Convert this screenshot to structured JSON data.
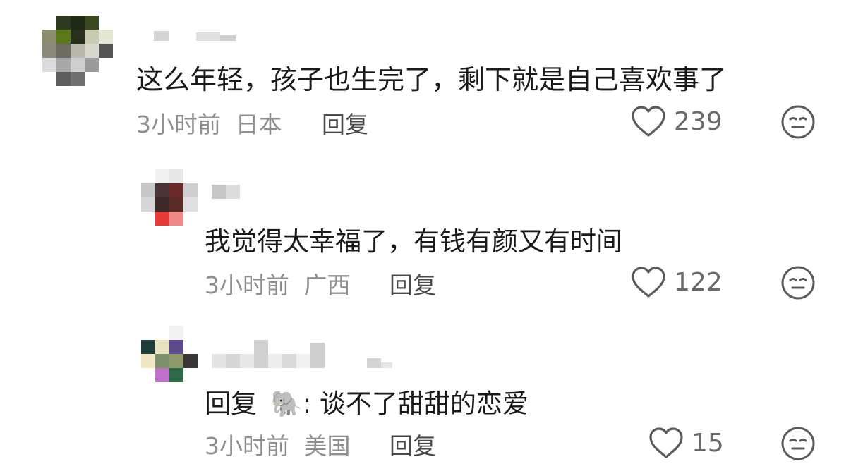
{
  "comments": [
    {
      "id": "c1",
      "text": "这么年轻，孩子也生完了，剩下就是自己喜欢事了",
      "time": "3小时前",
      "location": "日本",
      "reply_label": "回复",
      "likes": "239",
      "avatar_colors": [
        "#ffffff",
        "#2f3b21",
        "#1e2a14",
        "#3c4a22",
        "#ffffff",
        "#8c8f6e",
        "#5a7a1a",
        "#26301a",
        "#c9ccb0",
        "#e6e6d6",
        "#8a8a7c",
        "#6e6b60",
        "#b8b8ac",
        "#d8d8cc",
        "#555555",
        "#dcdcdc",
        "#a8a8a8",
        "#cfcfcf",
        "#9a9a9a",
        "#ffffff",
        "#ffffff",
        "#5e5e5e",
        "#707070",
        "#ffffff",
        "#ffffff"
      ]
    },
    {
      "id": "c2",
      "text": "我觉得太幸福了，有钱有颜又有时间",
      "time": "3小时前",
      "location": "广西",
      "reply_label": "回复",
      "likes": "122",
      "avatar_colors": [
        "#ffffff",
        "#f0f0f0",
        "#e8e8e8",
        "#ffffff",
        "#c8c8c8",
        "#4a3436",
        "#6a2a2c",
        "#cfcfcf",
        "#d6d6d6",
        "#3b2a28",
        "#5a2a26",
        "#e0e0e0",
        "#ffffff",
        "#e63b3b",
        "#f08a8a",
        "#ffffff"
      ]
    },
    {
      "id": "c3",
      "reply_prefix": "回复",
      "reply_to_emoji": "🐘",
      "reply_text": ": 谈不了甜甜的恋爱",
      "time": "3小时前",
      "location": "美国",
      "reply_label": "回复",
      "likes": "15",
      "avatar_colors": [
        "#ffffff",
        "#ffffff",
        "#f2f2f2",
        "#ffffff",
        "#1f3b3a",
        "#e8e2c0",
        "#5d4a8c",
        "#ffffff",
        "#efe8c2",
        "#7c8f6a",
        "#8f9a6a",
        "#3a3434",
        "#ffffff",
        "#c070c8",
        "#2c6a4a",
        "#ffffff"
      ]
    }
  ],
  "colors": {
    "text": "#1a1a1a",
    "meta": "#8f8f8f",
    "icon": "#5a5a5a"
  }
}
